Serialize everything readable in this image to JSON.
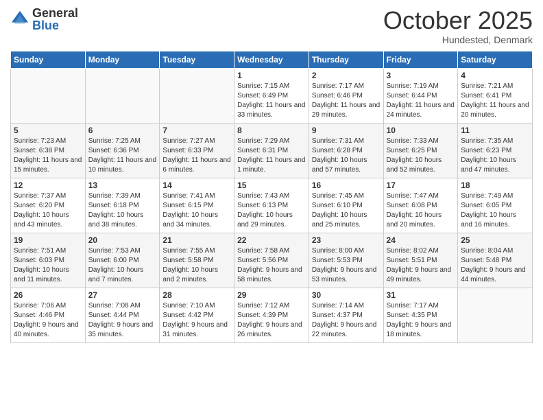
{
  "logo": {
    "general": "General",
    "blue": "Blue"
  },
  "header": {
    "month": "October 2025",
    "location": "Hundested, Denmark"
  },
  "weekdays": [
    "Sunday",
    "Monday",
    "Tuesday",
    "Wednesday",
    "Thursday",
    "Friday",
    "Saturday"
  ],
  "weeks": [
    [
      {
        "day": "",
        "info": ""
      },
      {
        "day": "",
        "info": ""
      },
      {
        "day": "",
        "info": ""
      },
      {
        "day": "1",
        "sunrise": "Sunrise: 7:15 AM",
        "sunset": "Sunset: 6:49 PM",
        "daylight": "Daylight: 11 hours and 33 minutes."
      },
      {
        "day": "2",
        "sunrise": "Sunrise: 7:17 AM",
        "sunset": "Sunset: 6:46 PM",
        "daylight": "Daylight: 11 hours and 29 minutes."
      },
      {
        "day": "3",
        "sunrise": "Sunrise: 7:19 AM",
        "sunset": "Sunset: 6:44 PM",
        "daylight": "Daylight: 11 hours and 24 minutes."
      },
      {
        "day": "4",
        "sunrise": "Sunrise: 7:21 AM",
        "sunset": "Sunset: 6:41 PM",
        "daylight": "Daylight: 11 hours and 20 minutes."
      }
    ],
    [
      {
        "day": "5",
        "sunrise": "Sunrise: 7:23 AM",
        "sunset": "Sunset: 6:38 PM",
        "daylight": "Daylight: 11 hours and 15 minutes."
      },
      {
        "day": "6",
        "sunrise": "Sunrise: 7:25 AM",
        "sunset": "Sunset: 6:36 PM",
        "daylight": "Daylight: 11 hours and 10 minutes."
      },
      {
        "day": "7",
        "sunrise": "Sunrise: 7:27 AM",
        "sunset": "Sunset: 6:33 PM",
        "daylight": "Daylight: 11 hours and 6 minutes."
      },
      {
        "day": "8",
        "sunrise": "Sunrise: 7:29 AM",
        "sunset": "Sunset: 6:31 PM",
        "daylight": "Daylight: 11 hours and 1 minute."
      },
      {
        "day": "9",
        "sunrise": "Sunrise: 7:31 AM",
        "sunset": "Sunset: 6:28 PM",
        "daylight": "Daylight: 10 hours and 57 minutes."
      },
      {
        "day": "10",
        "sunrise": "Sunrise: 7:33 AM",
        "sunset": "Sunset: 6:25 PM",
        "daylight": "Daylight: 10 hours and 52 minutes."
      },
      {
        "day": "11",
        "sunrise": "Sunrise: 7:35 AM",
        "sunset": "Sunset: 6:23 PM",
        "daylight": "Daylight: 10 hours and 47 minutes."
      }
    ],
    [
      {
        "day": "12",
        "sunrise": "Sunrise: 7:37 AM",
        "sunset": "Sunset: 6:20 PM",
        "daylight": "Daylight: 10 hours and 43 minutes."
      },
      {
        "day": "13",
        "sunrise": "Sunrise: 7:39 AM",
        "sunset": "Sunset: 6:18 PM",
        "daylight": "Daylight: 10 hours and 38 minutes."
      },
      {
        "day": "14",
        "sunrise": "Sunrise: 7:41 AM",
        "sunset": "Sunset: 6:15 PM",
        "daylight": "Daylight: 10 hours and 34 minutes."
      },
      {
        "day": "15",
        "sunrise": "Sunrise: 7:43 AM",
        "sunset": "Sunset: 6:13 PM",
        "daylight": "Daylight: 10 hours and 29 minutes."
      },
      {
        "day": "16",
        "sunrise": "Sunrise: 7:45 AM",
        "sunset": "Sunset: 6:10 PM",
        "daylight": "Daylight: 10 hours and 25 minutes."
      },
      {
        "day": "17",
        "sunrise": "Sunrise: 7:47 AM",
        "sunset": "Sunset: 6:08 PM",
        "daylight": "Daylight: 10 hours and 20 minutes."
      },
      {
        "day": "18",
        "sunrise": "Sunrise: 7:49 AM",
        "sunset": "Sunset: 6:05 PM",
        "daylight": "Daylight: 10 hours and 16 minutes."
      }
    ],
    [
      {
        "day": "19",
        "sunrise": "Sunrise: 7:51 AM",
        "sunset": "Sunset: 6:03 PM",
        "daylight": "Daylight: 10 hours and 11 minutes."
      },
      {
        "day": "20",
        "sunrise": "Sunrise: 7:53 AM",
        "sunset": "Sunset: 6:00 PM",
        "daylight": "Daylight: 10 hours and 7 minutes."
      },
      {
        "day": "21",
        "sunrise": "Sunrise: 7:55 AM",
        "sunset": "Sunset: 5:58 PM",
        "daylight": "Daylight: 10 hours and 2 minutes."
      },
      {
        "day": "22",
        "sunrise": "Sunrise: 7:58 AM",
        "sunset": "Sunset: 5:56 PM",
        "daylight": "Daylight: 9 hours and 58 minutes."
      },
      {
        "day": "23",
        "sunrise": "Sunrise: 8:00 AM",
        "sunset": "Sunset: 5:53 PM",
        "daylight": "Daylight: 9 hours and 53 minutes."
      },
      {
        "day": "24",
        "sunrise": "Sunrise: 8:02 AM",
        "sunset": "Sunset: 5:51 PM",
        "daylight": "Daylight: 9 hours and 49 minutes."
      },
      {
        "day": "25",
        "sunrise": "Sunrise: 8:04 AM",
        "sunset": "Sunset: 5:48 PM",
        "daylight": "Daylight: 9 hours and 44 minutes."
      }
    ],
    [
      {
        "day": "26",
        "sunrise": "Sunrise: 7:06 AM",
        "sunset": "Sunset: 4:46 PM",
        "daylight": "Daylight: 9 hours and 40 minutes."
      },
      {
        "day": "27",
        "sunrise": "Sunrise: 7:08 AM",
        "sunset": "Sunset: 4:44 PM",
        "daylight": "Daylight: 9 hours and 35 minutes."
      },
      {
        "day": "28",
        "sunrise": "Sunrise: 7:10 AM",
        "sunset": "Sunset: 4:42 PM",
        "daylight": "Daylight: 9 hours and 31 minutes."
      },
      {
        "day": "29",
        "sunrise": "Sunrise: 7:12 AM",
        "sunset": "Sunset: 4:39 PM",
        "daylight": "Daylight: 9 hours and 26 minutes."
      },
      {
        "day": "30",
        "sunrise": "Sunrise: 7:14 AM",
        "sunset": "Sunset: 4:37 PM",
        "daylight": "Daylight: 9 hours and 22 minutes."
      },
      {
        "day": "31",
        "sunrise": "Sunrise: 7:17 AM",
        "sunset": "Sunset: 4:35 PM",
        "daylight": "Daylight: 9 hours and 18 minutes."
      },
      {
        "day": "",
        "info": ""
      }
    ]
  ]
}
